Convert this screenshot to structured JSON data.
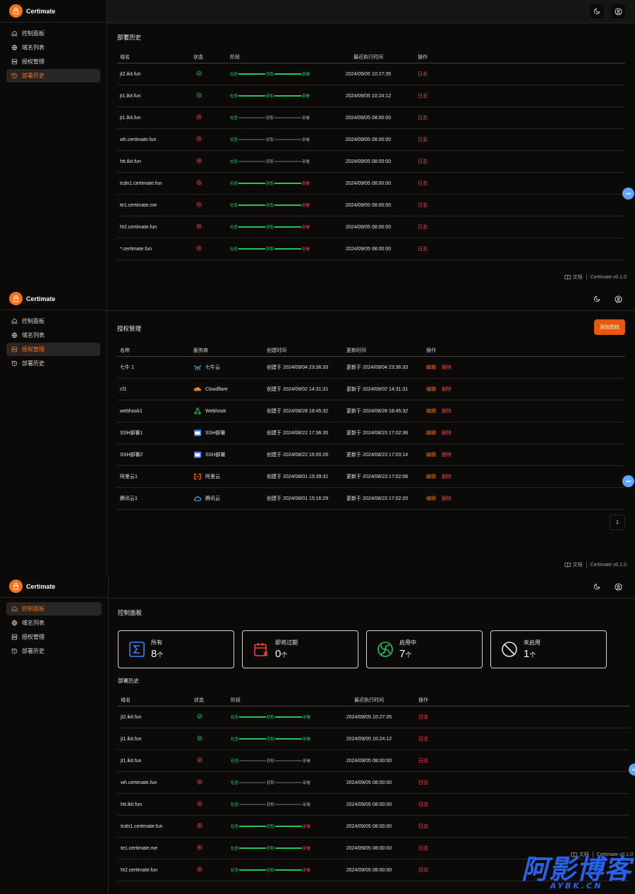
{
  "app": {
    "brand": "Certimate",
    "version": "Certimate v0.1.0",
    "docs": "文档",
    "dot_label": "28M"
  },
  "nav": [
    {
      "label": "控制面板",
      "icon": "home-icon"
    },
    {
      "label": "域名列表",
      "icon": "globe-icon"
    },
    {
      "label": "授权管理",
      "icon": "server-icon"
    },
    {
      "label": "部署历史",
      "icon": "history-icon"
    }
  ],
  "history": {
    "title": "部署历史",
    "columns": {
      "domain": "域名",
      "status": "状态",
      "stage": "阶段",
      "time": "最近执行时间",
      "op": "操作"
    },
    "stage_labels": [
      "检查",
      "获取",
      "部署"
    ],
    "log_label": "日志",
    "rows": [
      {
        "domain": "jt2.ikit.fun",
        "status": "success",
        "stages": [
          "g",
          "g",
          "g"
        ],
        "time": "2024/09/05 10:27:35"
      },
      {
        "domain": "jt1.ikit.fun",
        "status": "success",
        "stages": [
          "g",
          "g",
          "g"
        ],
        "time": "2024/09/05 10:24:12"
      },
      {
        "domain": "jt1.ikit.fun",
        "status": "fail",
        "stages": [
          "g",
          "n",
          "n"
        ],
        "time": "2024/09/05 08:00:00"
      },
      {
        "domain": "wh.certimate.fun",
        "status": "fail",
        "stages": [
          "g",
          "n",
          "n"
        ],
        "time": "2024/09/05 08:00:00"
      },
      {
        "domain": "htt.ikit.fun",
        "status": "fail",
        "stages": [
          "g",
          "n",
          "n"
        ],
        "time": "2024/09/05 08:00:00"
      },
      {
        "domain": "tcdn1.certimate.fun",
        "status": "fail",
        "stages": [
          "g",
          "g",
          "r"
        ],
        "time": "2024/09/05 08:00:00"
      },
      {
        "domain": "te1.certimate.me",
        "status": "fail",
        "stages": [
          "g",
          "g",
          "r"
        ],
        "time": "2024/09/05 08:00:00"
      },
      {
        "domain": "ht2.certimate.fun",
        "status": "fail",
        "stages": [
          "g",
          "g",
          "r"
        ],
        "time": "2024/09/05 08:00:00"
      },
      {
        "domain": "*.certimate.fun",
        "status": "fail",
        "stages": [
          "g",
          "g",
          "r"
        ],
        "time": "2024/09/05 08:00:00"
      }
    ]
  },
  "access": {
    "title": "授权管理",
    "add_button": "添加授权",
    "columns": {
      "name": "名称",
      "provider": "服务商",
      "created": "创建时间",
      "updated": "更新时间",
      "op": "操作"
    },
    "edit_label": "编辑",
    "delete_label": "删除",
    "page": "1",
    "rows": [
      {
        "name": "七牛 1",
        "provider": "七牛云",
        "icon": "qiniu-icon",
        "created": "创建于 2024/09/04 23:36:33",
        "updated": "更新于 2024/09/04 23:36:33"
      },
      {
        "name": "cf1",
        "provider": "Cloudflare",
        "icon": "cloudflare-icon",
        "created": "创建于 2024/09/02 14:31:31",
        "updated": "更新于 2024/09/02 14:31:31"
      },
      {
        "name": "webhook1",
        "provider": "Webhook",
        "icon": "webhook-icon",
        "created": "创建于 2024/08/28 18:45:32",
        "updated": "更新于 2024/08/28 18:45:32"
      },
      {
        "name": "SSH部署1",
        "provider": "SSH部署",
        "icon": "ssh-icon",
        "created": "创建于 2024/08/22 17:36:35",
        "updated": "更新于 2024/08/23 17:02:36"
      },
      {
        "name": "SSH部署2",
        "provider": "SSH部署",
        "icon": "ssh-icon",
        "created": "创建于 2024/08/22 16:00:26",
        "updated": "更新于 2024/08/23 17:03:14"
      },
      {
        "name": "阿里云1",
        "provider": "阿里云",
        "icon": "aliyun-icon",
        "created": "创建于 2024/08/01 15:39:31",
        "updated": "更新于 2024/08/23 17:02:08"
      },
      {
        "name": "腾讯云1",
        "provider": "腾讯云",
        "icon": "tencent-icon",
        "created": "创建于 2024/08/01 15:16:29",
        "updated": "更新于 2024/08/23 17:02:20"
      }
    ]
  },
  "dashboard": {
    "title": "控制面板",
    "unit": "个",
    "stats": [
      {
        "label": "所有",
        "value": "8",
        "icon": "sigma-icon",
        "color": "#3b82f6"
      },
      {
        "label": "即将过期",
        "value": "0",
        "icon": "calendar-x-icon",
        "color": "#ef4444"
      },
      {
        "label": "启用中",
        "value": "7",
        "icon": "loader-icon",
        "color": "#22c55e"
      },
      {
        "label": "未启用",
        "value": "1",
        "icon": "ban-icon",
        "color": "#e7e5e4"
      }
    ],
    "history_title": "部署历史"
  },
  "watermark": {
    "big": "阿影博客",
    "small": "AYBK.CN"
  }
}
